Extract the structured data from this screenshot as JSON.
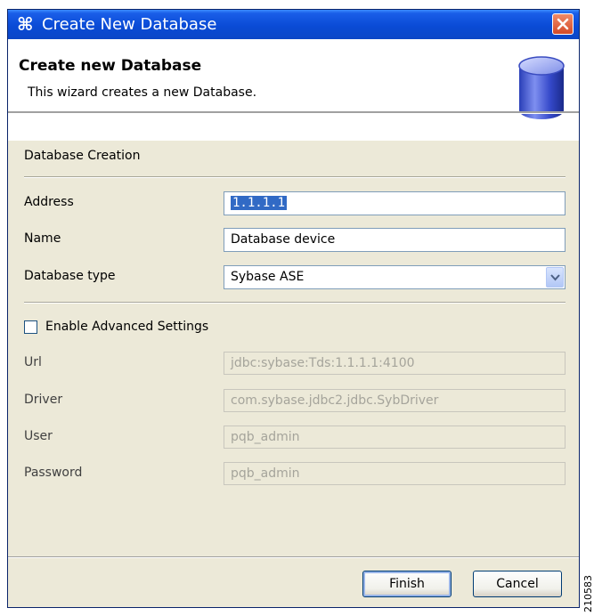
{
  "window": {
    "title": "Create New Database",
    "app_icon": "⌘"
  },
  "header": {
    "title": "Create new Database",
    "description": "This wizard creates a new Database."
  },
  "section": {
    "label": "Database Creation"
  },
  "fields": {
    "address": {
      "label": "Address",
      "value": "1.1.1.1"
    },
    "name": {
      "label": "Name",
      "value": "Database device"
    },
    "database_type": {
      "label": "Database type",
      "value": "Sybase ASE"
    }
  },
  "advanced": {
    "checkbox_label": "Enable Advanced Settings",
    "checked": false,
    "url": {
      "label": "Url",
      "value": "jdbc:sybase:Tds:1.1.1.1:4100"
    },
    "driver": {
      "label": "Driver",
      "value": "com.sybase.jdbc2.jdbc.SybDriver"
    },
    "user": {
      "label": "User",
      "value": "pqb_admin"
    },
    "password": {
      "label": "Password",
      "value": "pqb_admin"
    }
  },
  "buttons": {
    "finish": "Finish",
    "cancel": "Cancel"
  },
  "side_number": "210583",
  "colors": {
    "titlebar": "#0a4bd6",
    "dialog_bg": "#ece9d8",
    "selection": "#316ac5",
    "close_button": "#d44a28"
  }
}
